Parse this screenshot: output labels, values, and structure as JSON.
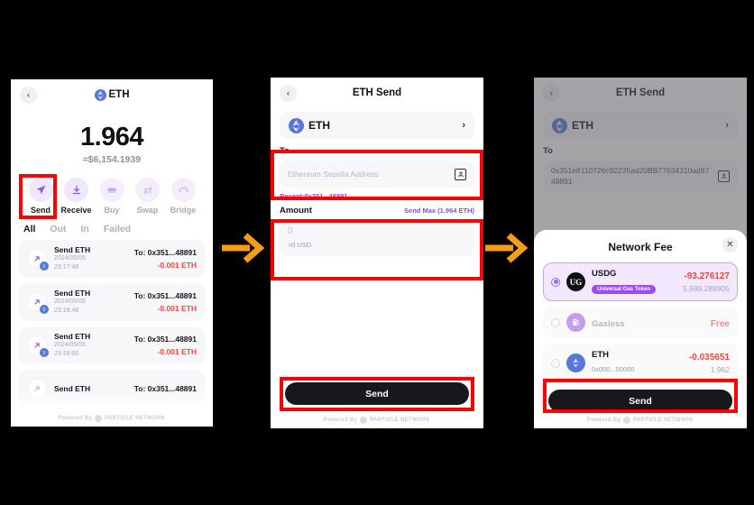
{
  "meta": {
    "background": "#000000",
    "accent_purple": "#7c4dff",
    "danger_red": "#f0483e",
    "highlight_red": "#fe0000",
    "arrow_orange": "#f59c18"
  },
  "arrows": [
    {
      "name": "arrow-step-1-to-2",
      "label": "next-step-arrow"
    },
    {
      "name": "arrow-step-2-to-3",
      "label": "next-step-arrow"
    }
  ],
  "panel1": {
    "back_label": "‹",
    "title": "ETH",
    "balance": "1.964",
    "balance_usd": "≈$6,154.1939",
    "actions": [
      {
        "label": "Send",
        "icon": "send-icon",
        "enabled": true
      },
      {
        "label": "Receive",
        "icon": "receive-icon",
        "enabled": true
      },
      {
        "label": "Buy",
        "icon": "buy-icon",
        "enabled": false
      },
      {
        "label": "Swap",
        "icon": "swap-icon",
        "enabled": false
      },
      {
        "label": "Bridge",
        "icon": "bridge-icon",
        "enabled": false
      }
    ],
    "tabs": [
      {
        "label": "All",
        "active": true
      },
      {
        "label": "Out",
        "active": false
      },
      {
        "label": "In",
        "active": false
      },
      {
        "label": "Failed",
        "active": false
      }
    ],
    "transactions": [
      {
        "title": "Send ETH",
        "date": "2024/05/05",
        "time": "23:17:48",
        "to": "To: 0x351...48891",
        "amount": "-0.001 ETH"
      },
      {
        "title": "Send ETH",
        "date": "2024/05/05",
        "time": "23:16:48",
        "to": "To: 0x351...48891",
        "amount": "-0.001 ETH"
      },
      {
        "title": "Send ETH",
        "date": "2024/05/05",
        "time": "23:16:00",
        "to": "To: 0x351...48891",
        "amount": "-0.001 ETH"
      },
      {
        "title": "Send ETH",
        "date": "",
        "time": "",
        "to": "To: 0x351...48891",
        "amount": ""
      }
    ],
    "powered_by": "Powered By",
    "powered_brand": "PARTICLE NETWORK"
  },
  "panel2": {
    "back_label": "‹",
    "title": "ETH Send",
    "token": {
      "name": "ETH",
      "chevron": "›"
    },
    "to_label": "To",
    "to_placeholder": "Ethereum Sepolia Address",
    "recent": "Recent:0x351...48891",
    "amount_label": "Amount",
    "send_max": "Send Max (1.964 ETH)",
    "amount_value": "0",
    "amount_usd": "≈0 USD",
    "send_button": "Send",
    "powered_by": "Powered By",
    "powered_brand": "PARTICLE NETWORK"
  },
  "panel3": {
    "back_label": "‹",
    "title": "ETH Send",
    "token": {
      "name": "ETH",
      "chevron": "›"
    },
    "to_label": "To",
    "to_value": "0x351e8110726c92235ad20BB77634310ad9748891",
    "modal": {
      "title": "Network Fee",
      "close_label": "✕",
      "options": [
        {
          "name": "USDG",
          "badge": "Universal Gas Token",
          "sub": "",
          "amount": "-93.276127",
          "balance": "5,989.288905",
          "icon": "usdg-token-icon",
          "selected": true,
          "free": false
        },
        {
          "name": "Gasless",
          "badge": "",
          "sub": "",
          "amount": "Free",
          "balance": "",
          "icon": "gas-pump-icon",
          "selected": false,
          "free": true
        },
        {
          "name": "ETH",
          "badge": "",
          "sub": "0x000...00000",
          "amount": "-0.035651",
          "balance": "1.962",
          "icon": "eth-token-icon",
          "selected": false,
          "free": false
        }
      ],
      "send_button": "Send"
    },
    "powered_by": "Powered By",
    "powered_brand": "PARTICLE NETWORK"
  }
}
